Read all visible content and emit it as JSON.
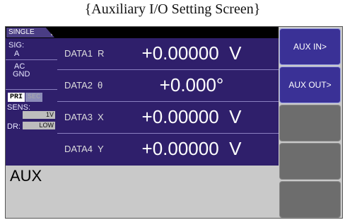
{
  "caption": "{Auxiliary I/O Setting Screen}",
  "mode_tab": "SINGLE",
  "left_panel": {
    "sig_label": "SIG:",
    "sig_value": "A",
    "coupling_line1": "AC",
    "coupling_line2": "GND",
    "pri": "PRI",
    "sec": "SEC",
    "sens_label": "SENS:",
    "sens_value": "1V",
    "dr_label": "DR:",
    "dr_value": "LOW"
  },
  "data_rows": [
    {
      "name": "DATA1",
      "symbol": "R",
      "value": "+0.00000  V"
    },
    {
      "name": "DATA2",
      "symbol": "θ",
      "value": "+0.000°"
    },
    {
      "name": "DATA3",
      "symbol": "X",
      "value": "+0.00000  V"
    },
    {
      "name": "DATA4",
      "symbol": "Y",
      "value": "+0.00000  V"
    }
  ],
  "screen_label": "AUX",
  "softkeys": [
    "AUX IN>",
    "AUX OUT>",
    "",
    "",
    ""
  ]
}
